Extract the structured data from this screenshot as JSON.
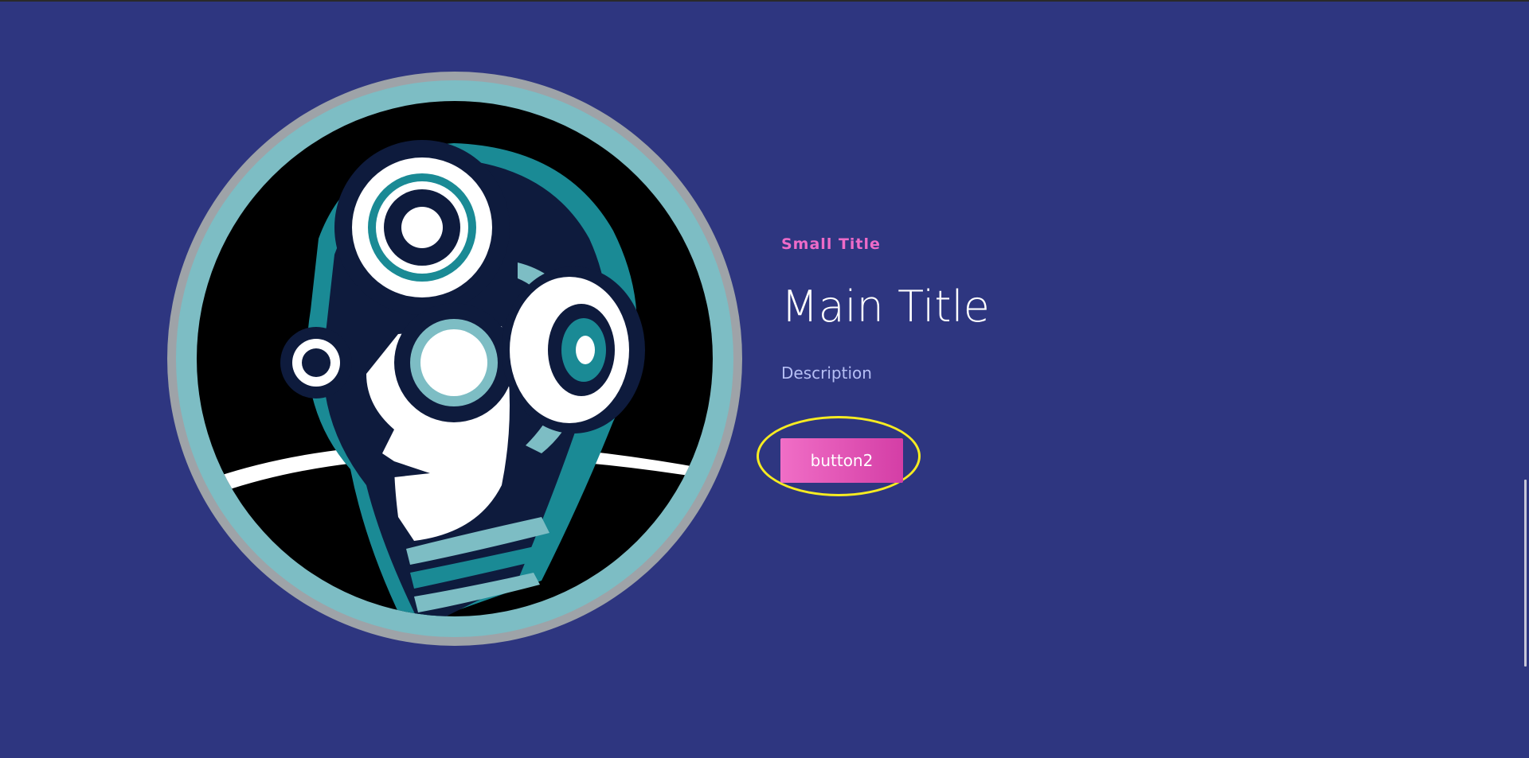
{
  "hero": {
    "small_title": "Small Title",
    "main_title": "Main Title",
    "description": "Description",
    "button_label": "button2"
  },
  "colors": {
    "background": "#2e3680",
    "small_title": "#ee6bc8",
    "description": "#b6bff5",
    "button_gradient_start": "#f06ec6",
    "button_gradient_end": "#d43ea6",
    "highlight_ring": "#f7ec21",
    "illustration_teal": "#7dbdc4",
    "illustration_navy": "#0e1b3d"
  },
  "icons": {
    "illustration": "robot-head-gears-illustration"
  }
}
